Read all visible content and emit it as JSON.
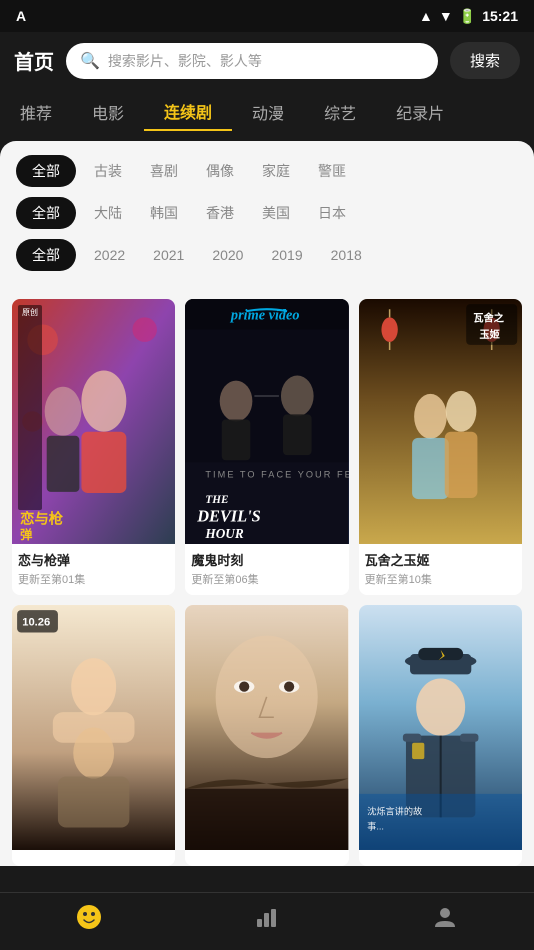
{
  "statusBar": {
    "appIcon": "A",
    "time": "15:21",
    "icons": [
      "signal",
      "wifi",
      "battery"
    ]
  },
  "header": {
    "title": "首页",
    "searchPlaceholder": "搜索影片、影院、影人等",
    "searchButtonLabel": "搜索"
  },
  "navTabs": [
    {
      "id": "recommend",
      "label": "推荐",
      "active": false
    },
    {
      "id": "movie",
      "label": "电影",
      "active": false
    },
    {
      "id": "series",
      "label": "连续剧",
      "active": true
    },
    {
      "id": "anime",
      "label": "动漫",
      "active": false
    },
    {
      "id": "variety",
      "label": "综艺",
      "active": false
    },
    {
      "id": "documentary",
      "label": "纪录片",
      "active": false
    }
  ],
  "filters": [
    {
      "allLabel": "全部",
      "tags": [
        "古装",
        "喜剧",
        "偶像",
        "家庭",
        "警匪"
      ]
    },
    {
      "allLabel": "全部",
      "tags": [
        "大陆",
        "韩国",
        "香港",
        "美国",
        "日本"
      ]
    },
    {
      "allLabel": "全部",
      "tags": [
        "2022",
        "2021",
        "2020",
        "2019",
        "2018"
      ]
    }
  ],
  "contentCards": [
    {
      "id": "card1",
      "title": "恋与枪弹",
      "sub": "更新至第01集",
      "poster": "poster1",
      "badge": ""
    },
    {
      "id": "card2",
      "title": "魔鬼时刻",
      "sub": "更新至第06集",
      "poster": "poster2",
      "badge": "prime video"
    },
    {
      "id": "card3",
      "title": "瓦舍之玉姬",
      "sub": "更新至第10集",
      "poster": "poster3",
      "badge": ""
    },
    {
      "id": "card4",
      "title": "",
      "sub": "",
      "poster": "poster4",
      "badge": "10.26"
    },
    {
      "id": "card5",
      "title": "",
      "sub": "",
      "poster": "poster5",
      "badge": ""
    },
    {
      "id": "card6",
      "title": "",
      "sub": "",
      "poster": "poster6",
      "badge": ""
    }
  ],
  "bottomNav": [
    {
      "id": "home",
      "icon": "😊",
      "active": true
    },
    {
      "id": "chart",
      "icon": "📊",
      "active": false
    },
    {
      "id": "profile",
      "icon": "👤",
      "active": false
    }
  ]
}
